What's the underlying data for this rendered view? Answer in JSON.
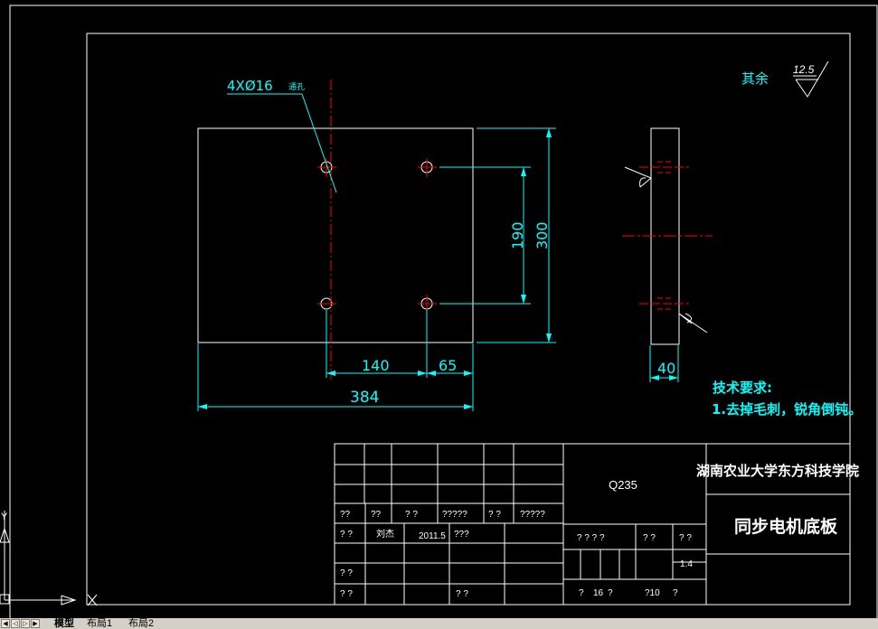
{
  "drawing": {
    "roughness_label": "其余",
    "roughness_value": "12.5",
    "hole_callout": "4XØ16",
    "hole_note": "通孔",
    "dims": {
      "d384": "384",
      "d140": "140",
      "d65": "65",
      "d190": "190",
      "d300": "300",
      "d40": "40"
    },
    "tech_title": "技术要求:",
    "tech_item": "1.去掉毛刺，锐角倒钝。"
  },
  "title_block": {
    "material": "Q235",
    "school": "湖南农业大学东方科技学院",
    "part_name": "同步电机底板",
    "row1": [
      "??",
      "??",
      "? ?",
      "?????",
      "? ?",
      "?????"
    ],
    "drafter": [
      "? ?",
      "刘杰",
      "2011.5",
      "???"
    ],
    "mid": [
      "? ? ? ?",
      "? ?",
      "? ?"
    ],
    "scale": "1:4",
    "check": "? ?",
    "approve": [
      "? ?",
      "? ?"
    ],
    "sheet": [
      "?",
      "16",
      "?",
      "?10",
      "?"
    ]
  },
  "ucs": {
    "y": "Y",
    "x": "X"
  },
  "tabs": {
    "model": "模型",
    "layout1": "布局1",
    "layout2": "布局2"
  },
  "colors": {
    "background": "#000000",
    "lines": "#ffffff",
    "dimensions": "#00ffff",
    "centerlines": "#ff0000",
    "tab_bar": "#d4d0c8"
  }
}
